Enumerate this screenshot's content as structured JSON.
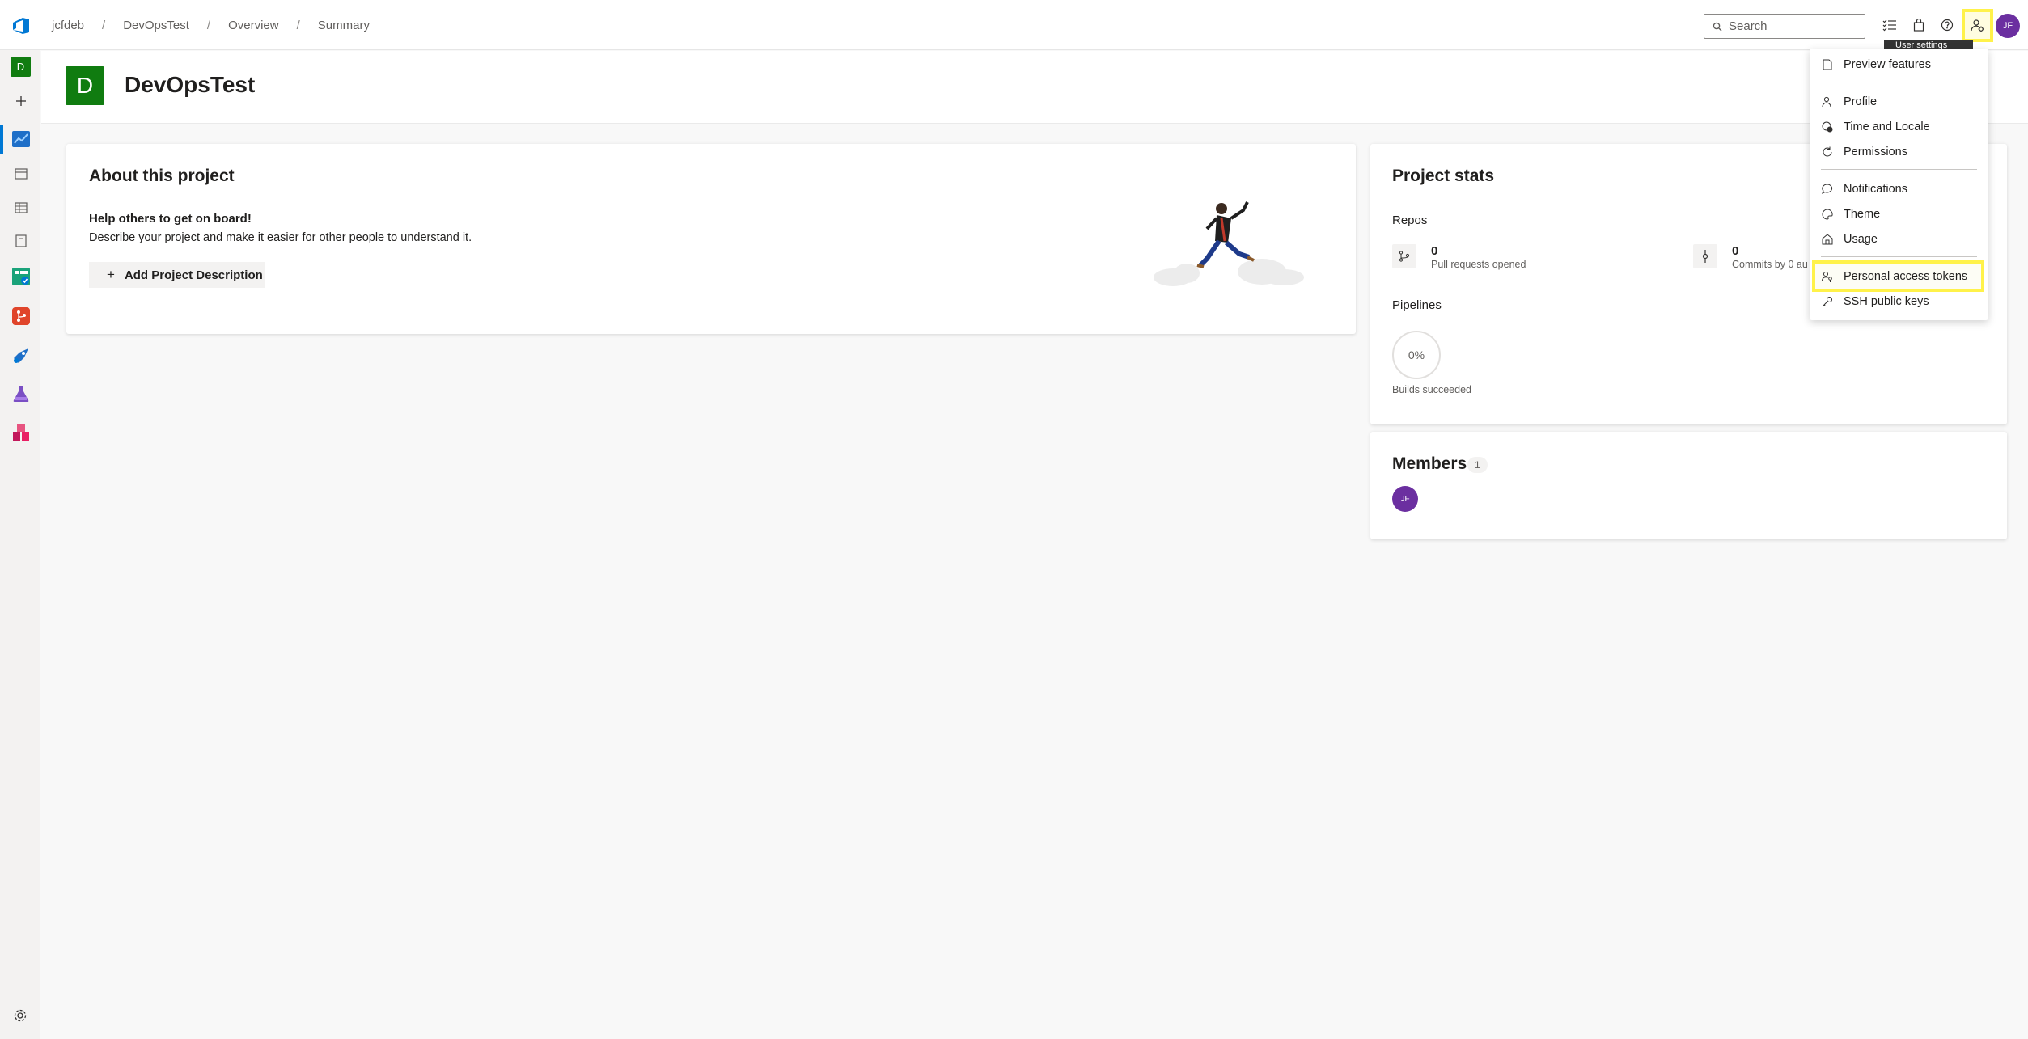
{
  "breadcrumb": [
    "jcfdeb",
    "DevOpsTest",
    "Overview",
    "Summary"
  ],
  "search": {
    "placeholder": "Search"
  },
  "tooltip": "User settings",
  "user": {
    "initials": "JF"
  },
  "rail": {
    "project_initial": "D"
  },
  "project": {
    "initial": "D",
    "name": "DevOpsTest"
  },
  "about": {
    "title": "About this project",
    "help_title": "Help others to get on board!",
    "help_desc": "Describe your project and make it easier for other people to understand it.",
    "add_button": "Add Project Description"
  },
  "stats": {
    "title": "Project stats",
    "repos_label": "Repos",
    "pull_requests": {
      "value": "0",
      "label": "Pull requests opened"
    },
    "commits": {
      "value": "0",
      "label": "Commits by 0 au"
    },
    "pipelines_label": "Pipelines",
    "builds": {
      "value": "0%",
      "label": "Builds succeeded"
    }
  },
  "members": {
    "title": "Members",
    "count": "1",
    "list": [
      "JF"
    ]
  },
  "menu": {
    "items": [
      {
        "label": "Preview features",
        "icon": "page-icon"
      },
      {
        "label": "Profile",
        "icon": "person-icon"
      },
      {
        "label": "Time and Locale",
        "icon": "globe-clock-icon"
      },
      {
        "label": "Permissions",
        "icon": "refresh-shield-icon"
      },
      {
        "label": "Notifications",
        "icon": "chat-bubble-icon"
      },
      {
        "label": "Theme",
        "icon": "palette-icon"
      },
      {
        "label": "Usage",
        "icon": "usage-icon"
      },
      {
        "label": "Personal access tokens",
        "icon": "key-person-icon"
      },
      {
        "label": "SSH public keys",
        "icon": "key-icon"
      }
    ]
  },
  "colors": {
    "accent": "#0078d4",
    "project_tile": "#107c10",
    "avatar": "#6b2fa0",
    "highlight": "#fff24a"
  }
}
